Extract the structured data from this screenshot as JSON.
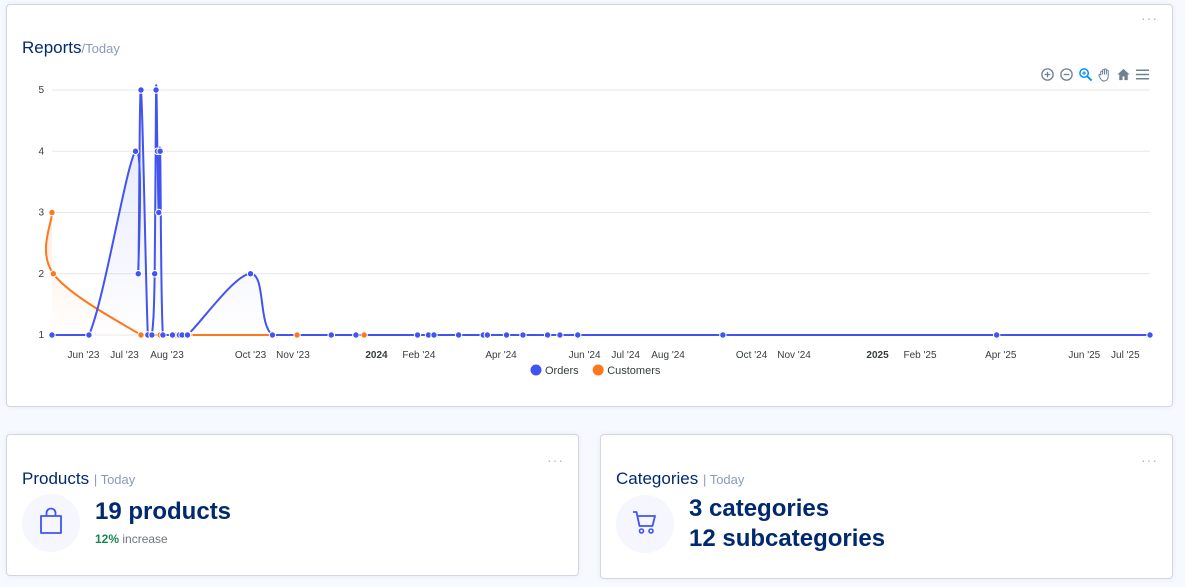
{
  "reports": {
    "title": "Reports",
    "period": "/Today",
    "menu": "···",
    "toolbar": [
      "zoom-in-icon",
      "zoom-out-icon",
      "selection-zoom-icon",
      "pan-hand-icon",
      "reset-home-icon",
      "menu-icon"
    ]
  },
  "chart_data": {
    "type": "line",
    "x_type": "datetime",
    "ylim": [
      1,
      5
    ],
    "y_ticks": [
      "1",
      "2",
      "3",
      "4",
      "5"
    ],
    "x_ticks": [
      {
        "date": "2023-06-01",
        "label": "Jun '23",
        "bold": false
      },
      {
        "date": "2023-07-01",
        "label": "Jul '23",
        "bold": false
      },
      {
        "date": "2023-08-01",
        "label": "Aug '23",
        "bold": false
      },
      {
        "date": "2023-10-01",
        "label": "Oct '23",
        "bold": false
      },
      {
        "date": "2023-11-01",
        "label": "Nov '23",
        "bold": false
      },
      {
        "date": "2024-01-01",
        "label": "2024",
        "bold": true
      },
      {
        "date": "2024-02-01",
        "label": "Feb '24",
        "bold": false
      },
      {
        "date": "2024-04-01",
        "label": "Apr '24",
        "bold": false
      },
      {
        "date": "2024-06-01",
        "label": "Jun '24",
        "bold": false
      },
      {
        "date": "2024-07-01",
        "label": "Jul '24",
        "bold": false
      },
      {
        "date": "2024-08-01",
        "label": "Aug '24",
        "bold": false
      },
      {
        "date": "2024-10-01",
        "label": "Oct '24",
        "bold": false
      },
      {
        "date": "2024-11-01",
        "label": "Nov '24",
        "bold": false
      },
      {
        "date": "2025-01-01",
        "label": "2025",
        "bold": true
      },
      {
        "date": "2025-02-01",
        "label": "Feb '25",
        "bold": false
      },
      {
        "date": "2025-04-01",
        "label": "Apr '25",
        "bold": false
      },
      {
        "date": "2025-06-01",
        "label": "Jun '25",
        "bold": false
      },
      {
        "date": "2025-07-01",
        "label": "Jul '25",
        "bold": false
      }
    ],
    "grid": true,
    "legend": "bottom-center",
    "series": [
      {
        "name": "Orders",
        "color": "#4154f1",
        "points": [
          {
            "x": "2023-05-09",
            "y": 1
          },
          {
            "x": "2023-06-05",
            "y": 1
          },
          {
            "x": "2023-07-09",
            "y": 4
          },
          {
            "x": "2023-07-11",
            "y": 2
          },
          {
            "x": "2023-07-13",
            "y": 5
          },
          {
            "x": "2023-07-18",
            "y": 1
          },
          {
            "x": "2023-07-21",
            "y": 1
          },
          {
            "x": "2023-07-23",
            "y": 2
          },
          {
            "x": "2023-07-24",
            "y": 5
          },
          {
            "x": "2023-07-25",
            "y": 4
          },
          {
            "x": "2023-07-26",
            "y": 3
          },
          {
            "x": "2023-07-27",
            "y": 4
          },
          {
            "x": "2023-07-29",
            "y": 1
          },
          {
            "x": "2023-08-05",
            "y": 1
          },
          {
            "x": "2023-08-10",
            "y": 1
          },
          {
            "x": "2023-08-12",
            "y": 1
          },
          {
            "x": "2023-08-16",
            "y": 1
          },
          {
            "x": "2023-10-01",
            "y": 2
          },
          {
            "x": "2023-10-17",
            "y": 1
          },
          {
            "x": "2023-11-29",
            "y": 1
          },
          {
            "x": "2023-12-17",
            "y": 1
          },
          {
            "x": "2024-01-31",
            "y": 1
          },
          {
            "x": "2024-02-08",
            "y": 1
          },
          {
            "x": "2024-02-12",
            "y": 1
          },
          {
            "x": "2024-03-01",
            "y": 1
          },
          {
            "x": "2024-03-19",
            "y": 1
          },
          {
            "x": "2024-03-22",
            "y": 1
          },
          {
            "x": "2024-04-05",
            "y": 1
          },
          {
            "x": "2024-04-17",
            "y": 1
          },
          {
            "x": "2024-05-05",
            "y": 1
          },
          {
            "x": "2024-05-14",
            "y": 1
          },
          {
            "x": "2024-05-27",
            "y": 1
          },
          {
            "x": "2024-09-10",
            "y": 1
          },
          {
            "x": "2025-03-29",
            "y": 1
          },
          {
            "x": "2025-07-19",
            "y": 1
          }
        ]
      },
      {
        "name": "Customers",
        "color": "#ff771d",
        "points": [
          {
            "x": "2023-05-09",
            "y": 3
          },
          {
            "x": "2023-05-10",
            "y": 2
          },
          {
            "x": "2023-07-13",
            "y": 1
          },
          {
            "x": "2023-07-21",
            "y": 1
          },
          {
            "x": "2023-07-27",
            "y": 1
          },
          {
            "x": "2023-08-07",
            "y": 1
          },
          {
            "x": "2023-08-17",
            "y": 1
          },
          {
            "x": "2023-11-04",
            "y": 1
          },
          {
            "x": "2023-11-29",
            "y": 1
          },
          {
            "x": "2023-12-17",
            "y": 1
          },
          {
            "x": "2023-12-23",
            "y": 1
          }
        ]
      }
    ]
  },
  "products": {
    "title": "Products",
    "period": "| Today",
    "menu": "···",
    "icon": "shopping-bag-icon",
    "value": "19 products",
    "change": "12%",
    "change_label": "increase",
    "change_color": "#198754"
  },
  "categories": {
    "title": "Categories",
    "period": "| Today",
    "menu": "···",
    "icon": "shopping-cart-icon",
    "line1": "3 categories",
    "line2": "12 subcategories"
  },
  "colors": {
    "accent": "#4154f1",
    "orange": "#ff771d",
    "navy": "#012970",
    "muted": "#899bbd"
  }
}
